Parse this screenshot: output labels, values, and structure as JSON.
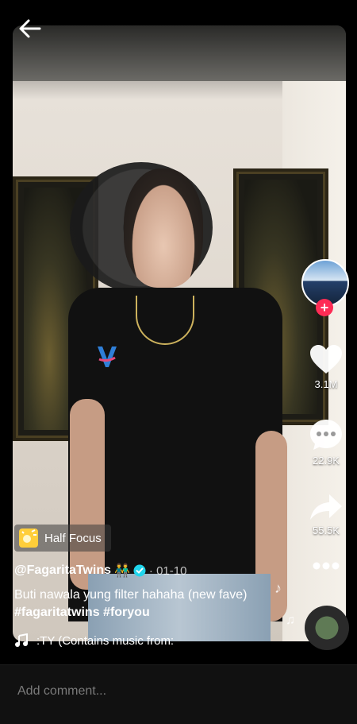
{
  "video": {
    "effect_label": "Half Focus",
    "username": "@FagaritaTwins",
    "username_emoji": "👬",
    "date": "· 01-10",
    "caption_text": "Buti nawala yung filter hahaha (new fave)",
    "hashtags": [
      "#fagaritatwins",
      "#foryou"
    ],
    "music_text": ":TY (Contains music from:"
  },
  "actions": {
    "likes": "3.1M",
    "comments": "22.9K",
    "shares": "55.5K"
  },
  "comment_bar": {
    "placeholder": "Add comment..."
  },
  "colors": {
    "follow_badge": "#fe2c55",
    "verified_badge": "#20d5ec",
    "effect_icon": "#ffce3a"
  }
}
